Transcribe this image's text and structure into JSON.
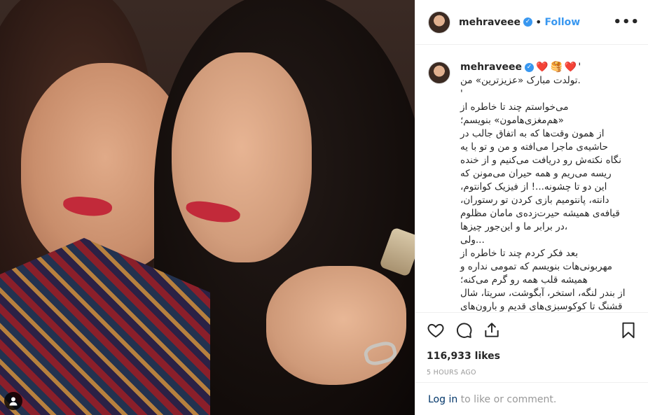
{
  "post": {
    "username": "mehraveee",
    "follow_label": "Follow",
    "more_label": "•••",
    "caption_prefix": "'",
    "caption_emojis": [
      "❤️",
      "🥞",
      "❤️"
    ],
    "caption_text": ".تولدت مبارک «عزیزترین» من\n'\nمی‌خواستم چند تا خاطره از\n«هم‌مغزی‌هامون» بنویسم؛\nاز همون وقت‌ها که به اتفاق جالب در\nحاشیه‌ی ماجرا می‌افته و من و تو با یه\nنگاه نکته‌ش رو دریافت می‌کنیم و از خنده\nریسه می‌ریم و همه حیران می‌مونن که\nاین دو تا چشونه...! از فیزیک کوانتوم،\nدانته، پانتومیم بازی کردن تو رستوران،\nقیافه‌ی همیشه حیرت‌زده‌ی مامان مظلوم\n،در برابر ما و این‌جور چیزها\n...ولی\nبعد فکر کردم چند تا خاطره از\nمهربونی‌هات بنویسم که تمومی نداره و\nهمیشه قلب همه رو گرم می‌کنه؛\nاز بندر لنگه، استخر، آبگوشت، سریتا، شال\nقشنگ تا کوکوسبزی‌های قدیم و بارون‌های\nشمال و کوه‌ها و ...",
    "likes": "116,933 likes",
    "time": "5 HOURS AGO",
    "login_link": "Log in",
    "login_rest": " to like or comment."
  },
  "icons": [
    "heart-icon",
    "comment-icon",
    "share-icon",
    "bookmark-icon",
    "verified-icon",
    "user-tag-icon"
  ],
  "colors": {
    "accent": "#3897f0",
    "text": "#262626",
    "muted": "#999999",
    "link": "#003569"
  }
}
